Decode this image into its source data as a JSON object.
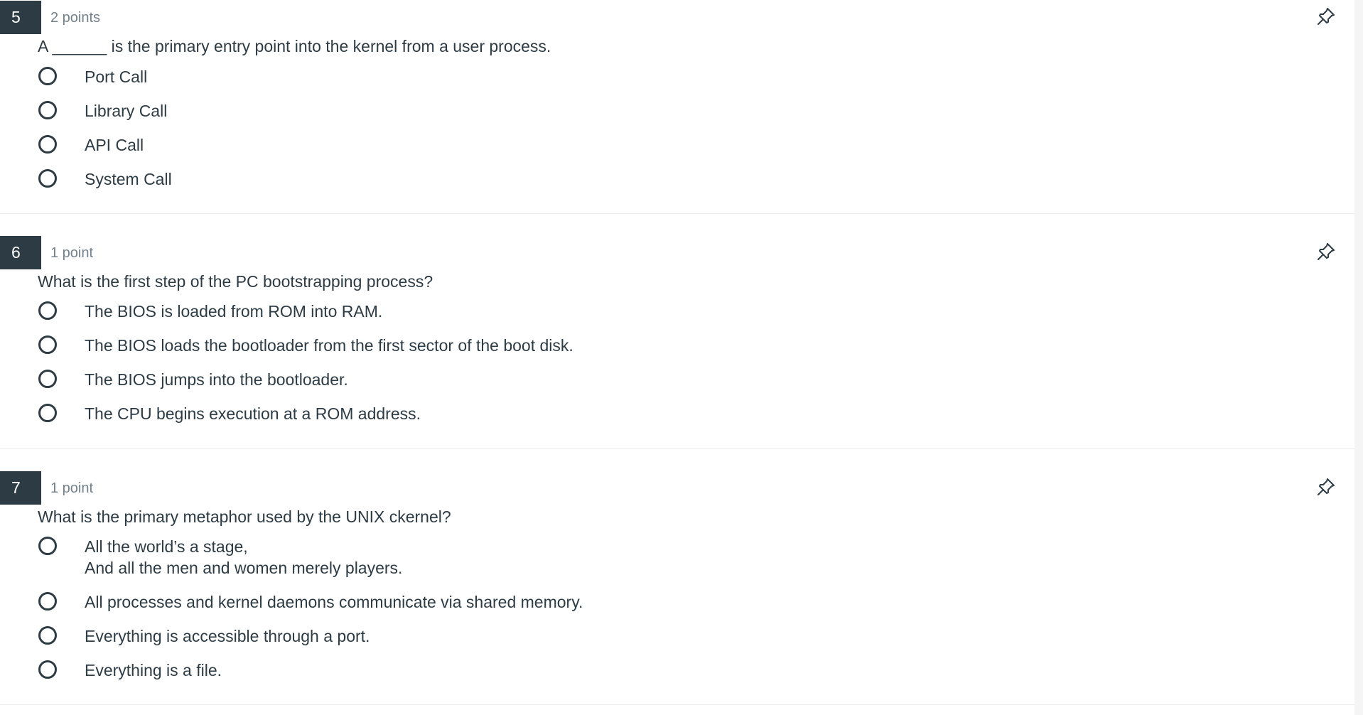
{
  "questions": [
    {
      "number": "5",
      "points": "2 points",
      "text": "A ______ is the primary entry point into the kernel from a user process.",
      "answers": [
        {
          "label": "Port Call"
        },
        {
          "label": "Library Call"
        },
        {
          "label": "API Call"
        },
        {
          "label": "System Call"
        }
      ],
      "pin_icon": "pin-icon"
    },
    {
      "number": "6",
      "points": "1 point",
      "text": "What is the first step of the PC bootstrapping process?",
      "answers": [
        {
          "label": "The BIOS is loaded from ROM into RAM."
        },
        {
          "label": "The BIOS loads the bootloader from the first sector of the boot disk."
        },
        {
          "label": "The BIOS jumps into the bootloader."
        },
        {
          "label": "The CPU begins execution at a ROM address."
        }
      ],
      "pin_icon": "pin-icon"
    },
    {
      "number": "7",
      "points": "1 point",
      "text": "What is the primary metaphor used by the UNIX ckernel?",
      "answers": [
        {
          "label_line1": "All the world’s a stage,",
          "label_line2": "And all the men and women merely players."
        },
        {
          "label": "All processes and kernel daemons communicate via shared memory."
        },
        {
          "label": "Everything is accessible through a port."
        },
        {
          "label": "Everything is a file."
        }
      ],
      "pin_icon": "pin-icon"
    }
  ],
  "colors": {
    "number_badge_bg": "#2d3b45",
    "text": "#2d3b45",
    "points_text": "#73818c",
    "divider": "#eceeef"
  }
}
